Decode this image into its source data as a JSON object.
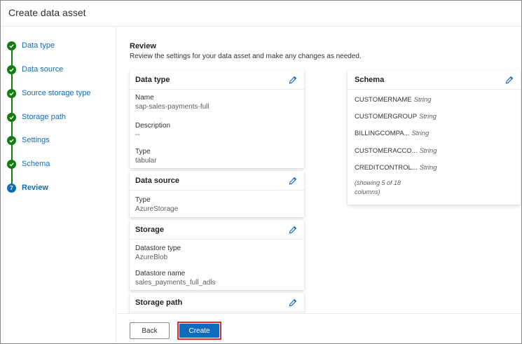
{
  "window": {
    "title": "Create data asset"
  },
  "steps": [
    {
      "label": "Data type",
      "state": "done"
    },
    {
      "label": "Data source",
      "state": "done"
    },
    {
      "label": "Source storage type",
      "state": "done"
    },
    {
      "label": "Storage path",
      "state": "done"
    },
    {
      "label": "Settings",
      "state": "done"
    },
    {
      "label": "Schema",
      "state": "done"
    },
    {
      "label": "Review",
      "state": "current",
      "badge": "7"
    }
  ],
  "review": {
    "title": "Review",
    "subtitle": "Review the settings for your data asset and make any changes as needed."
  },
  "cards": {
    "data_type": {
      "title": "Data type",
      "name_label": "Name",
      "name_value": "sap-sales-payments-full",
      "description_label": "Description",
      "description_value": "--",
      "type_label": "Type",
      "type_value": "tabular"
    },
    "data_source": {
      "title": "Data source",
      "type_label": "Type",
      "type_value": "AzureStorage"
    },
    "storage": {
      "title": "Storage",
      "datastore_type_label": "Datastore type",
      "datastore_type_value": "AzureBlob",
      "datastore_name_label": "Datastore name",
      "datastore_name_value": "sales_payments_full_adls"
    },
    "storage_path": {
      "title": "Storage path"
    },
    "schema": {
      "title": "Schema",
      "columns": [
        {
          "name": "CUSTOMERNAME",
          "type": "String"
        },
        {
          "name": "CUSTOMERGROUP",
          "type": "String"
        },
        {
          "name": "BILLINGCOMPA...",
          "type": "String"
        },
        {
          "name": "CUSTOMERACCO...",
          "type": "String"
        },
        {
          "name": "CREDITCONTROL...",
          "type": "String"
        }
      ],
      "note": "(showing 5 of 18 columns)"
    }
  },
  "footer": {
    "back_label": "Back",
    "create_label": "Create"
  },
  "colors": {
    "accent": "#0f6cbd",
    "done": "#107c10",
    "highlight": "#e3272b"
  },
  "icons": {
    "step_done": "checkmark-icon",
    "edit": "pencil-icon"
  }
}
